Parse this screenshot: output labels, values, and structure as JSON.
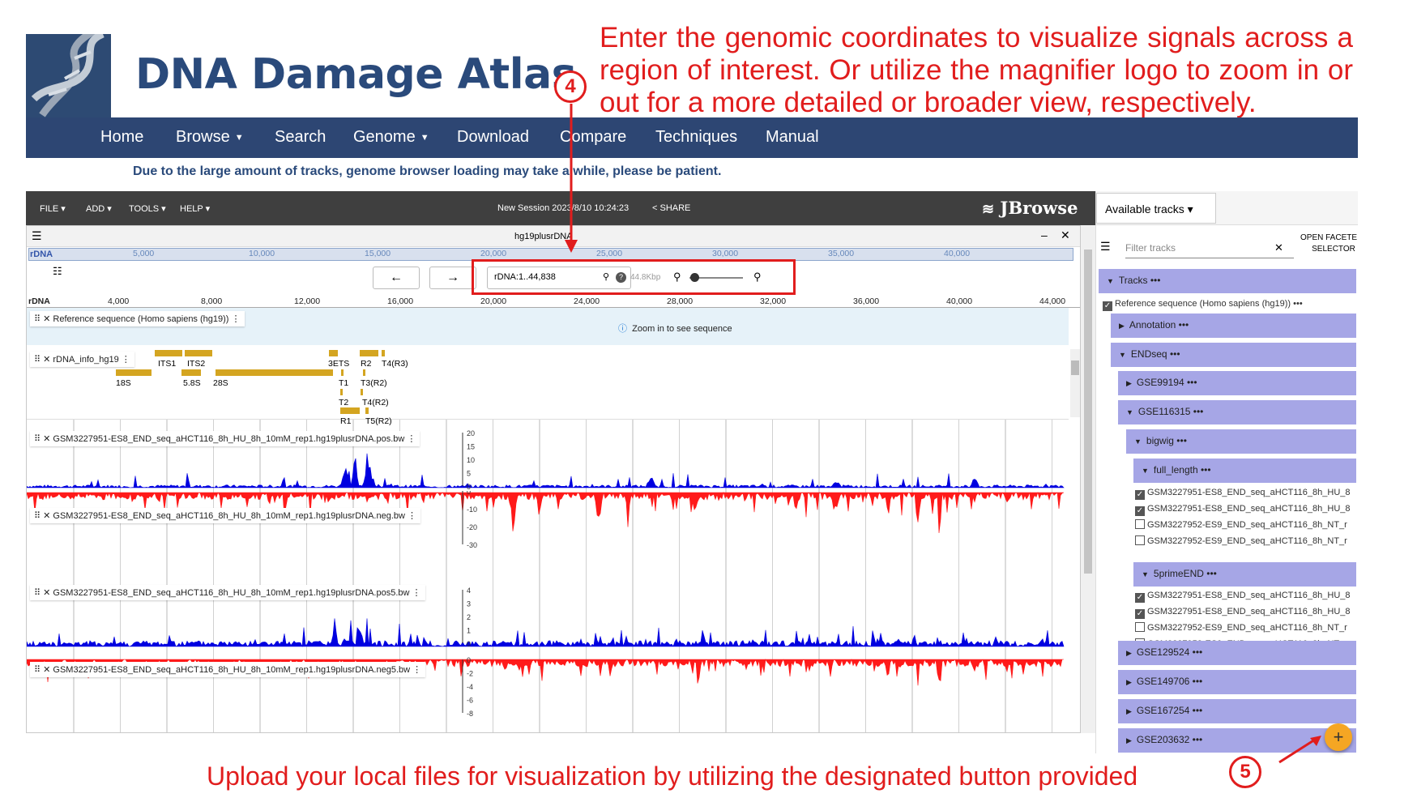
{
  "site": {
    "title": "DNA Damage Atlas",
    "notice": "Due to the large amount of tracks, genome browser loading may take a while, please be patient.",
    "nav": [
      {
        "label": "Home"
      },
      {
        "label": "Browse"
      },
      {
        "label": "Search"
      },
      {
        "label": "Genome"
      },
      {
        "label": "Download"
      },
      {
        "label": "Compare"
      },
      {
        "label": "Techniques"
      },
      {
        "label": "Manual"
      }
    ]
  },
  "callouts": {
    "top_lines": [
      "Enter the genomic coordinates to visualize signals across a",
      "region of interest. Or utilize the magnifier logo to zoom in or",
      "out for a more detailed or broader view, respectively."
    ],
    "bottom": "Upload your local files for visualization by utilizing the designated button provided",
    "marker_4": "4",
    "marker_5": "5",
    "color": "#e11d1d"
  },
  "jbrowse": {
    "menus": [
      "FILE",
      "ADD",
      "TOOLS",
      "HELP"
    ],
    "session": "New Session 2023/8/10 10:24:23",
    "share": "SHARE",
    "brand": "JBrowse",
    "view_title": "hg19plusrDNA",
    "overview_ref": "rDNA",
    "overview_ticks": [
      "5,000",
      "10,000",
      "15,000",
      "20,000",
      "25,000",
      "30,000",
      "35,000",
      "40,000"
    ],
    "location": "rDNA:1..44,838",
    "span": "44.8Kbp",
    "ruler_ref": "rDNA",
    "ruler_ticks": [
      "4,000",
      "8,000",
      "12,000",
      "16,000",
      "20,000",
      "24,000",
      "28,000",
      "32,000",
      "36,000",
      "40,000",
      "44,000"
    ],
    "zoom_msg": "Zoom in to see sequence",
    "tracks": [
      "Reference sequence (Homo sapiens (hg19))",
      "rDNA_info_hg19",
      "GSM3227951-ES8_END_seq_aHCT116_8h_HU_8h_10mM_rep1.hg19plusrDNA.pos.bw",
      "GSM3227951-ES8_END_seq_aHCT116_8h_HU_8h_10mM_rep1.hg19plusrDNA.neg.bw",
      "GSM3227951-ES8_END_seq_aHCT116_8h_HU_8h_10mM_rep1.hg19plusrDNA.pos5.bw",
      "GSM3227951-ES8_END_seq_aHCT116_8h_HU_8h_10mM_rep1.hg19plusrDNA.neg5.bw"
    ],
    "features": [
      "ITS1",
      "ITS2",
      "3ETS",
      "R2",
      "T4(R3)",
      "18S",
      "5.8S",
      "28S",
      "T1",
      "T3(R2)",
      "T2",
      "T4(R2)",
      "R1",
      "T5(R2)"
    ],
    "axes": {
      "pos": [
        "20",
        "15",
        "10",
        "5",
        "0"
      ],
      "neg": [
        "0",
        "-10",
        "-20",
        "-30"
      ],
      "pos5": [
        "4",
        "3",
        "2",
        "1",
        "0"
      ],
      "neg5": [
        "0",
        "-2",
        "-4",
        "-6",
        "-8"
      ]
    }
  },
  "panel": {
    "title": "Available tracks",
    "filter_placeholder": "Filter tracks",
    "open_faceted_1": "OPEN FACETE",
    "open_faceted_2": "SELECTOR",
    "tracks_header": "Tracks",
    "ref_seq": "Reference sequence (Homo sapiens (hg19))",
    "annotation": "Annotation",
    "endseq": "ENDseq",
    "gse99194": "GSE99194",
    "gse116315": "GSE116315",
    "bigwig": "bigwig",
    "full_length": "full_length",
    "full_items": [
      {
        "label": "GSM3227951-ES8_END_seq_aHCT116_8h_HU_8",
        "checked": true
      },
      {
        "label": "GSM3227951-ES8_END_seq_aHCT116_8h_HU_8",
        "checked": true
      },
      {
        "label": "GSM3227952-ES9_END_seq_aHCT116_8h_NT_r",
        "checked": false
      },
      {
        "label": "GSM3227952-ES9_END_seq_aHCT116_8h_NT_r",
        "checked": false
      }
    ],
    "fiveprime": "5primeEND",
    "five_items": [
      {
        "label": "GSM3227951-ES8_END_seq_aHCT116_8h_HU_8",
        "checked": true
      },
      {
        "label": "GSM3227951-ES8_END_seq_aHCT116_8h_HU_8",
        "checked": true
      },
      {
        "label": "GSM3227952-ES9_END_seq_aHCT116_8h_NT_r",
        "checked": false
      },
      {
        "label": "GSM3227952-ES9_END_seq_aHCT116_8h_NT_r",
        "checked": false
      }
    ],
    "gse_more": [
      "GSE129524",
      "GSE149706",
      "GSE167254",
      "GSE203632"
    ],
    "fab": "+"
  },
  "colors": {
    "pos": "#0000e0",
    "neg": "#ff1a1a",
    "nav": "#2d4673",
    "title": "#2a4a7b",
    "feature": "#d4a521"
  }
}
